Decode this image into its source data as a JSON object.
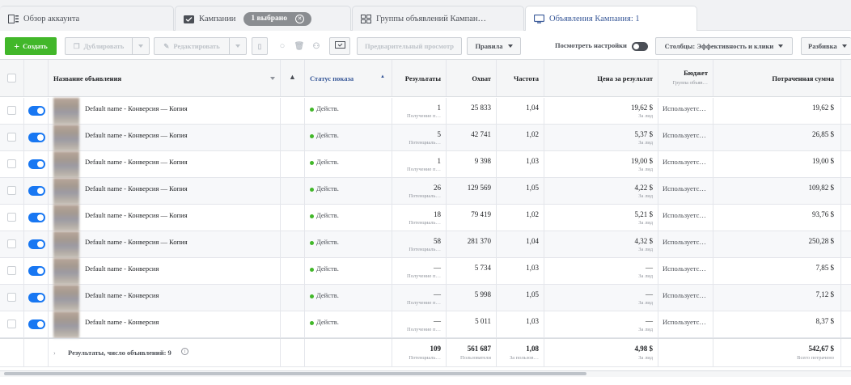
{
  "tabs": {
    "overview": "Обзор аккаунта",
    "campaigns": "Кампании",
    "selected": "1 выбрано",
    "adsets": "Группы объявлений Кампан…",
    "ads": "Объявления Кампания: 1"
  },
  "toolbar": {
    "create": "Создать",
    "duplicate": "Дублировать",
    "edit": "Редактировать",
    "preview": "Предварительный просмотр",
    "rules": "Правила",
    "view_settings": "Посмотреть настройки",
    "columns": "Столбцы: Эффективность и клики",
    "breakdown": "Разбивка"
  },
  "headers": {
    "name": "Название объявления",
    "status": "Статус показа",
    "results": "Результаты",
    "reach": "Охват",
    "frequency": "Частота",
    "cost": "Цена за результат",
    "budget": "Бюджет",
    "budget_sub": "Группа объяв…",
    "spent": "Потраченная сумма"
  },
  "rows": [
    {
      "name": "Default name - Конверсия — Копия",
      "status": "Действ.",
      "results": "1",
      "results_sub": "Получение п…",
      "reach": "25 833",
      "freq": "1,04",
      "cost": "19,62 $",
      "cost_sub": "За лид",
      "budget": "Используетс…",
      "spent": "19,62 $"
    },
    {
      "name": "Default name - Конверсия — Копия",
      "status": "Действ.",
      "results": "5",
      "results_sub": "Потенциаль…",
      "reach": "42 741",
      "freq": "1,02",
      "cost": "5,37 $",
      "cost_sub": "За лид",
      "budget": "Используетс…",
      "spent": "26,85 $"
    },
    {
      "name": "Default name - Конверсия — Копия",
      "status": "Действ.",
      "results": "1",
      "results_sub": "Получение п…",
      "reach": "9 398",
      "freq": "1,03",
      "cost": "19,00 $",
      "cost_sub": "За лид",
      "budget": "Используетс…",
      "spent": "19,00 $"
    },
    {
      "name": "Default name - Конверсия — Копия",
      "status": "Действ.",
      "results": "26",
      "results_sub": "Потенциаль…",
      "reach": "129 569",
      "freq": "1,05",
      "cost": "4,22 $",
      "cost_sub": "За лид",
      "budget": "Используетс…",
      "spent": "109,82 $"
    },
    {
      "name": "Default name - Конверсия — Копия",
      "status": "Действ.",
      "results": "18",
      "results_sub": "Потенциаль…",
      "reach": "79 419",
      "freq": "1,02",
      "cost": "5,21 $",
      "cost_sub": "За лид",
      "budget": "Используетс…",
      "spent": "93,76 $"
    },
    {
      "name": "Default name - Конверсия — Копия",
      "status": "Действ.",
      "results": "58",
      "results_sub": "Потенциаль…",
      "reach": "281 370",
      "freq": "1,04",
      "cost": "4,32 $",
      "cost_sub": "За лид",
      "budget": "Используетс…",
      "spent": "250,28 $"
    },
    {
      "name": "Default name - Конверсия",
      "status": "Действ.",
      "results": "—",
      "results_sub": "Получение п…",
      "reach": "5 734",
      "freq": "1,03",
      "cost": "—",
      "cost_sub": "За лид",
      "budget": "Используетс…",
      "spent": "7,85 $"
    },
    {
      "name": "Default name - Конверсия",
      "status": "Действ.",
      "results": "—",
      "results_sub": "Получение п…",
      "reach": "5 998",
      "freq": "1,05",
      "cost": "—",
      "cost_sub": "За лид",
      "budget": "Используетс…",
      "spent": "7,12 $"
    },
    {
      "name": "Default name - Конверсия",
      "status": "Действ.",
      "results": "—",
      "results_sub": "Получение п…",
      "reach": "5 011",
      "freq": "1,03",
      "cost": "—",
      "cost_sub": "За лид",
      "budget": "Используетс…",
      "spent": "8,37 $"
    }
  ],
  "totals": {
    "label": "Результаты, число объявлений: 9",
    "results": "109",
    "results_sub": "Потенциаль…",
    "reach": "561 687",
    "reach_sub": "Пользователи",
    "freq": "1,08",
    "freq_sub": "За пользов…",
    "cost": "4,98 $",
    "cost_sub": "За лид",
    "spent": "542,67 $",
    "spent_sub": "Всего потрачено"
  },
  "colors": {
    "accent": "#1877f2",
    "create": "#42b72a",
    "active_dot": "#42b72a"
  }
}
